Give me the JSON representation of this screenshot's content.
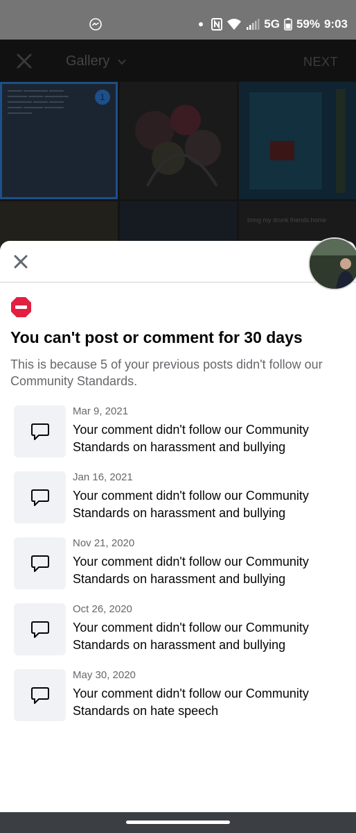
{
  "status_bar": {
    "network": "5G",
    "battery": "59%",
    "time": "9:03"
  },
  "background": {
    "title": "Gallery",
    "next_label": "NEXT",
    "tile_badge": "1",
    "tile_caption": "bring my drunk friends home"
  },
  "sheet": {
    "heading": "You can't post or comment for 30 days",
    "subtext": "This is because 5 of your previous posts didn't follow our Community Standards.",
    "items": [
      {
        "date": "Mar 9, 2021",
        "message": "Your comment didn't follow our Community Standards on harassment and bullying"
      },
      {
        "date": "Jan 16, 2021",
        "message": "Your comment didn't follow our Community Standards on harassment and bullying"
      },
      {
        "date": "Nov 21, 2020",
        "message": "Your comment didn't follow our Community Standards on harassment and bullying"
      },
      {
        "date": "Oct 26, 2020",
        "message": "Your comment didn't follow our Community Standards on harassment and bullying"
      },
      {
        "date": "May 30, 2020",
        "message": "Your comment didn't follow our Community Standards on hate speech"
      }
    ]
  },
  "icons": {
    "close": "close-icon",
    "stop": "stop-icon",
    "comment": "comment-icon",
    "messenger": "messenger-icon"
  },
  "colors": {
    "stop_red": "#e41e3f",
    "text_primary": "#050505",
    "text_secondary": "#65676b",
    "icon_box": "#f0f2f5"
  }
}
